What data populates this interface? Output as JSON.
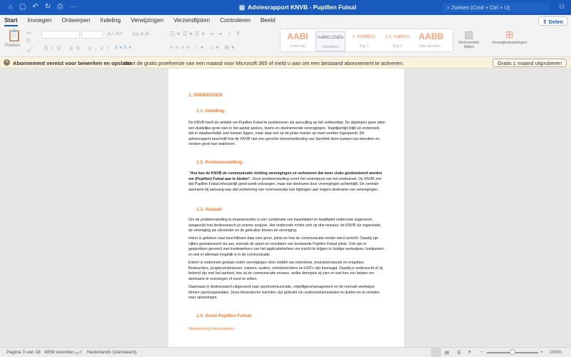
{
  "titlebar": {
    "title": "Adviesrapport KNVB - Pupillen Futsal",
    "search_placeholder": "Zoeken (Cmd + Ctrl + U)"
  },
  "tabs": [
    "Start",
    "Invoegen",
    "Ontwerpen",
    "Indeling",
    "Verwijzingen",
    "Verzendlijsten",
    "Controleren",
    "Beeld"
  ],
  "share_label": "Delen",
  "ribbon": {
    "paste": "Plakken",
    "styles": [
      {
        "preview": "AABI",
        "name": "Grote kop"
      },
      {
        "preview": "AaBbCcDdEe",
        "name": "Standaard"
      },
      {
        "preview": "1. AABBCC",
        "name": "Kop 1"
      },
      {
        "preview": "1.1. AaBbCc",
        "name": "Kop 2"
      },
      {
        "preview": "AABB",
        "name": "Kop van inho..."
      }
    ],
    "styles_pane": "Deelvenster Stijlen",
    "addins": "Invoegtoepassingen"
  },
  "banner": {
    "bold": "Abonnement vereist voor bewerken en opslaan",
    "text": "Start de gratis proefversie van een maand voor Microsoft 365 of meld u aan om een bestaand abonnement te activeren.",
    "button": "Gratis 1 maand uitproberen"
  },
  "document": {
    "h1": "1.   ONDERZOEK",
    "h11": "1.1. Inleiding:",
    "p1": "De KNVB heeft de ambitie om Pupillen Futsal te positioneren als aanvulling op het veldvoetbal. De afgelopen jaren laten een duidelijke groei zien in het aantal spelers, teams en deelnemende verenigingen. Tegelijkertijd blijkt uit onderzoek dat er daadwerkelijk veel kansen liggen, maar daar wel op de juiste manier op moet worden ingespeeld. Dit adviesrapport beschrijft hoe de KNVB met een gerichte doorontwikkeling van Sportlink deze kansen kan benutten en verdere groei kan realiseren.",
    "h12": "1.2. Probleemstelling:",
    "p2_bold": "' Hoe kan de KNVB de communicatie richting verenigingen zó verbeteren dat meer clubs gestimuleerd worden om (Pupillen) Futsal aan te bieden\".",
    "p2": " Deze probleemstelling vormt het vertrekpunt van het onderzoek. De KNVB ziet dat Pupillen Futsal inhoudelijk goed wordt ontvangen, maar dat deelname door verenigingen achterblijft. De centrale aanname bij aanvang was dat verbetering van communicatie kan bijdragen aan hogere deelname van verenigingen.",
    "h13": "1.3. Aanpak:",
    "p3": "Om de probleemstelling te beantwoorden is een combinatie van kwantitatief en kwalitatief onderzoek uitgevoerd, aangevuld met deskresearch en interne analyse. Het onderzoek richtte zich op drie niveaus: de KNVB als organisatie, de vereniging als uitvoerder en de gebruiker binnen de vereniging.",
    "p4": "Intern is gekeken naar beschikbare data over groei, pilots en hoe de communicatie eerder werd verricht. Daarbij zijn cijfers geanalyseerd via sas, evenals de opzet en resultaten van bestaande Pupillen Futsal pilots. Ook zijn er gesprekken gevoerd met medewerkers van het applicatiebeheer om inzicht te krijgen in huidige werkwijzen, knelpunten en wat er allemaal mogelijk is in de communicatie.",
    "p5": "Extern is onderzoek gedaan onder verenigingen door middel van interviews, brainstormsessie en enquêtes. Bestuurders, jeugdcoördinatoren, trainers, ouders, scheidsrechters en HJO's zijn bevraagd. Daarbij is onderzocht of zij bekend zijn met het aanbod, hoe zij de communicatie ervaren, welke drempels zij zien en wat hen zou helpen om deelname te overwegen of voort te zetten.",
    "p6": "Daarnaast is deskresearch uitgevoerd naar sportcommunicatie, vrijwilligersmanagement en de normale werkwijze binnen sportorganisaties. Deze theoretische inzichten zijn gebruikt om onderzoeksresultaten te duiden en te vertalen naar oplossingen.",
    "h14": "1.4. Groei Pupillen Futsal:",
    "sub": "Ontwikkeling Futsal spelers:"
  },
  "status": {
    "page": "Pagina 3 van 18",
    "words": "4859 woorden",
    "language": "Nederlands (standaard)",
    "zoom": "100%",
    "zoom_level": 100
  }
}
